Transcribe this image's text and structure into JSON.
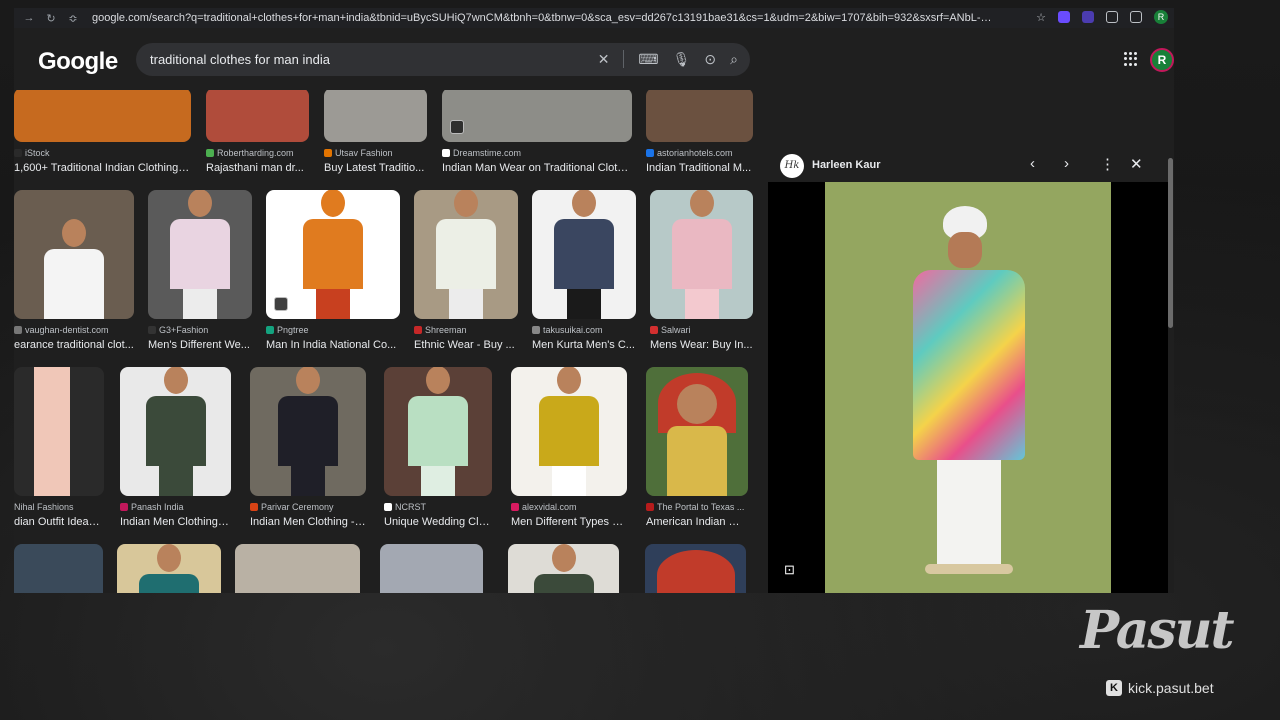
{
  "browser": {
    "url": "google.com/search?q=traditional+clothes+for+man+india&tbnid=uBycSUHiQ7wnCM&tbnh=0&tbnw=0&sca_esv=dd267c13191bae31&cs=1&udm=2&biw=1707&bih=932&sxsrf=ANbL-n6XHTHtOvao...",
    "profile_initial": "R"
  },
  "header": {
    "logo": "Google",
    "query": "traditional clothes for man india",
    "avatar_initial": "R"
  },
  "rows": [
    [
      {
        "source": "iStock",
        "title": "1,600+ Traditional Indian Clothing Fo...",
        "color": "#c66a1f",
        "fav": "#2a2a2a"
      },
      {
        "source": "Robertharding.com",
        "title": "Rajasthani man dr...",
        "color": "#b04c3b",
        "fav": "#4caf50"
      },
      {
        "source": "Utsav Fashion",
        "title": "Buy Latest Traditio...",
        "color": "#9c9a95",
        "fav": "#e37400"
      },
      {
        "source": "Dreamstime.com",
        "title": "Indian Man Wear on Traditional Clothe...",
        "color": "#8d8d88",
        "fav": "#ffffff"
      },
      {
        "source": "astorianhotels.com",
        "title": "Indian Traditional M...",
        "color": "#6b5140",
        "fav": "#1a73e8"
      }
    ],
    [
      {
        "source": "vaughan-dentist.com",
        "title": "earance traditional clot...",
        "color": "#6a5d50",
        "fav": "#777"
      },
      {
        "source": "G3+Fashion",
        "title": "Men's Different We...",
        "color": "#5a5a5a",
        "fav": "#333"
      },
      {
        "source": "Pngtree",
        "title": "Man In India National Co...",
        "color": "#ffffff",
        "fav": "#14a37f"
      },
      {
        "source": "Shreeman",
        "title": "Ethnic Wear - Buy ...",
        "color": "#a89a84",
        "fav": "#c62828"
      },
      {
        "source": "takusuikai.com",
        "title": "Men Kurta Men's C...",
        "color": "#f2f2f2",
        "fav": "#888"
      },
      {
        "source": "Salwari",
        "title": "Mens Wear: Buy In...",
        "color": "#b7c9c8",
        "fav": "#d32f2f"
      }
    ],
    [
      {
        "source": "Nihal Fashions",
        "title": "dian Outfit Ideas ...",
        "color": "#2a2a2a",
        "fav": "#222"
      },
      {
        "source": "Panash India",
        "title": "Indian Men Clothing: ...",
        "color": "#e9e9e9",
        "fav": "#c2185b"
      },
      {
        "source": "Parivar Ceremony",
        "title": "Indian Men Clothing - ...",
        "color": "#6f6a60",
        "fav": "#d84315"
      },
      {
        "source": "NCRST",
        "title": "Unique Wedding Clot...",
        "color": "#5b4037",
        "fav": "#ffffff"
      },
      {
        "source": "alexvidal.com",
        "title": "Men Different Types O...",
        "color": "#f3f1ec",
        "fav": "#d81b60"
      },
      {
        "source": "The Portal to Texas ...",
        "title": "American Indian Ma...",
        "color": "#4f6f3a",
        "fav": "#b71c1c"
      }
    ],
    [
      {
        "color": "#3a4a5a"
      },
      {
        "color": "#d8c79a"
      },
      {
        "color": "#b9b1a4"
      },
      {
        "color": "#a3a8b2"
      },
      {
        "color": "#dedcd6"
      },
      {
        "color": "#2f3f5a"
      }
    ]
  ],
  "panel": {
    "source": "Harleen Kaur",
    "logo_glyph": "Hk"
  },
  "watermark": {
    "brand": "Pasut",
    "url": "kick.pasut.bet",
    "k_glyph": "K"
  },
  "icons": [
    "back-icon",
    "reload-icon",
    "star-icon",
    "clear-icon",
    "keyboard-icon",
    "mic-icon",
    "lens-icon",
    "search-icon",
    "apps-icon",
    "prev-icon",
    "next-icon",
    "more-icon",
    "close-icon"
  ]
}
